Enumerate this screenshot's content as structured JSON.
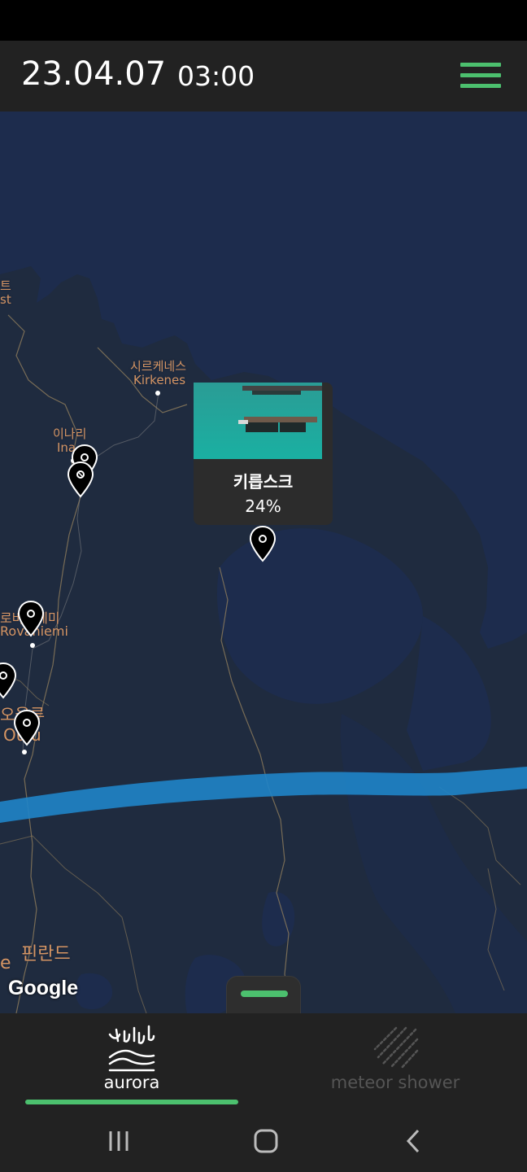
{
  "header": {
    "date": "23.04.07",
    "time": "03:00"
  },
  "map": {
    "labels": [
      {
        "text": "트",
        "name": "map-label-tromso-ko"
      },
      {
        "text": "st",
        "name": "map-label-tromso-en"
      },
      {
        "text": "시르케네스",
        "name": "map-label-kirkenes-ko"
      },
      {
        "text": "Kirkenes",
        "name": "map-label-kirkenes-en"
      },
      {
        "text": "이나리",
        "name": "map-label-inari-ko"
      },
      {
        "text": "Ina",
        "name": "map-label-inari-en"
      },
      {
        "text": "로바니에미",
        "name": "map-label-rovaniemi-ko"
      },
      {
        "text": "Rovaniemi",
        "name": "map-label-rovaniemi-en"
      },
      {
        "text": "오울루",
        "name": "map-label-oulu-ko"
      },
      {
        "text": "Oulu",
        "name": "map-label-oulu-en"
      },
      {
        "text": "핀란드",
        "name": "map-label-finland"
      },
      {
        "text": "e",
        "name": "map-label-edge"
      }
    ],
    "attribution": "Google",
    "aurora_band_color": "#1f84c8"
  },
  "popup": {
    "name": "키릅스크",
    "percent": "24%"
  },
  "tabs": [
    {
      "label": "aurora",
      "icon": "aurora-icon",
      "active": true
    },
    {
      "label": "meteor shower",
      "icon": "meteor-shower-icon",
      "active": false
    }
  ],
  "colors": {
    "accent": "#4cc06e",
    "header_bg": "#222222",
    "map_bg": "#1d2c4d",
    "map_label": "#d59563"
  },
  "nav": {
    "recents": "recents-icon",
    "home": "home-icon",
    "back": "back-icon"
  }
}
